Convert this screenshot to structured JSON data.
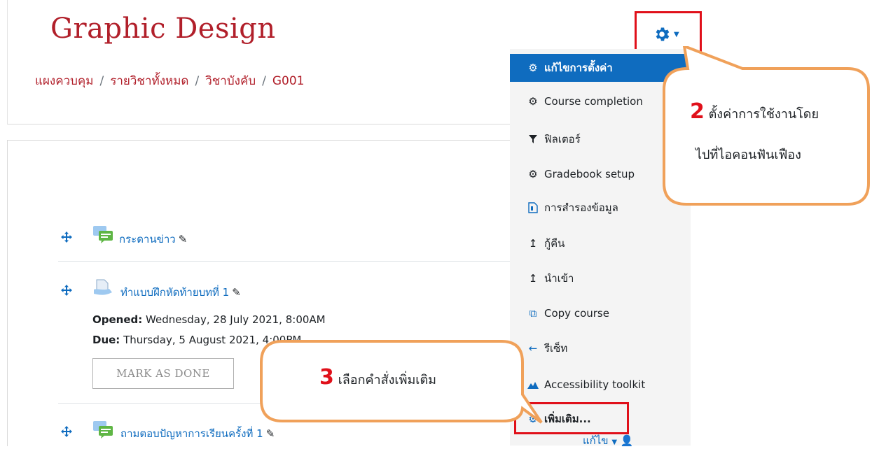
{
  "page": {
    "title": "Graphic Design",
    "breadcrumb": [
      "แผงควบคุม",
      "รายวิชาทั้งหมด",
      "วิชาบังคับ",
      "G001"
    ],
    "breadcrumb_separator": "/"
  },
  "activities": [
    {
      "name": "กระดานข่าว",
      "icon": "forum-icon"
    },
    {
      "name": "ทำแบบฝึกหัดท้ายบทที่ 1",
      "icon": "assignment-icon",
      "opened_label": "Opened:",
      "opened_value": "Wednesday, 28 July 2021, 8:00AM",
      "due_label": "Due:",
      "due_value": "Thursday, 5 August 2021, 4:00PM",
      "mark_done": "MARK AS DONE"
    },
    {
      "name": "ถามตอบปัญหาการเรียนครั้งที่ 1",
      "icon": "forum-icon"
    }
  ],
  "dropdown": {
    "items": [
      {
        "label": "แก้ไขการตั้งค่า",
        "icon": "gear-icon",
        "active": true
      },
      {
        "label": "Course completion",
        "icon": "gear-icon"
      },
      {
        "label": "ฟิลเตอร์",
        "icon": "filter-icon"
      },
      {
        "label": "Gradebook setup",
        "icon": "gear-icon"
      },
      {
        "label": "การสำรองข้อมูล",
        "icon": "backup-file-icon"
      },
      {
        "label": "กู้คืน",
        "icon": "upload-arrow-icon"
      },
      {
        "label": "นำเข้า",
        "icon": "upload-arrow-icon"
      },
      {
        "label": "Copy course",
        "icon": "copy-icon"
      },
      {
        "label": "รีเซ็ท",
        "icon": "left-arrow-icon"
      },
      {
        "label": "Accessibility toolkit",
        "icon": "mountain-icon"
      },
      {
        "label": "เพิ่มเติม...",
        "icon": "gear-icon"
      }
    ]
  },
  "callouts": {
    "settings": {
      "number": "2",
      "line1": "ตั้งค่าการใช้งานโดย",
      "line2": "ไปที่ไอคอนฟันเฟือง"
    },
    "more": {
      "number": "3",
      "text": "เลือกคำสั่งเพิ่มเติม"
    }
  },
  "footer": {
    "edit_label": "แก้ไข"
  },
  "colors": {
    "accent": "#0f6cbf",
    "title": "#b11f2a",
    "highlight": "#e0101a",
    "callout_border": "#f0a15a"
  }
}
